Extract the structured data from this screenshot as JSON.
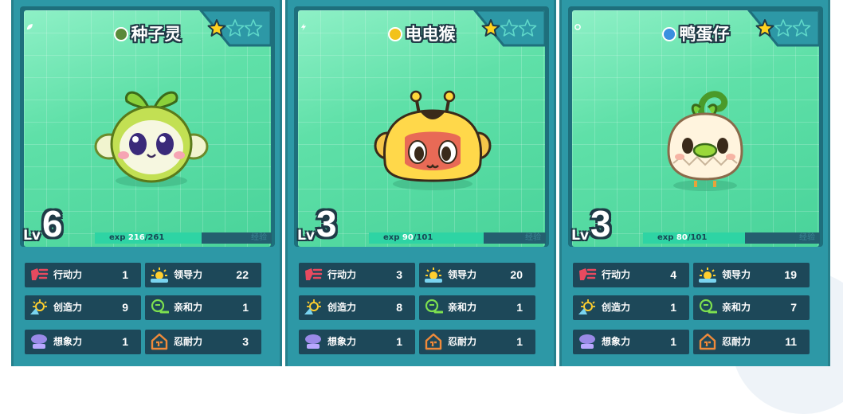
{
  "cards": [
    {
      "name": "种子灵",
      "type_icon": "leaf-type-icon",
      "type_color": "#5a8a3a",
      "stars_filled": 1,
      "stars_total": 3,
      "level_label": "Lv",
      "level": "6",
      "exp_label": "exp",
      "exp_current": "216",
      "exp_max": "/261",
      "exp_fraction": 0.83,
      "exp_tag": "经验",
      "creature": "seed-sprite",
      "stats": [
        {
          "label": "行动力",
          "value": "1",
          "icon": "action-icon"
        },
        {
          "label": "领导力",
          "value": "22",
          "icon": "leadership-icon"
        },
        {
          "label": "创造力",
          "value": "9",
          "icon": "creativity-icon"
        },
        {
          "label": "亲和力",
          "value": "1",
          "icon": "affinity-icon"
        },
        {
          "label": "想象力",
          "value": "1",
          "icon": "imagination-icon"
        },
        {
          "label": "忍耐力",
          "value": "3",
          "icon": "endurance-icon"
        }
      ]
    },
    {
      "name": "电电猴",
      "type_icon": "lightning-type-icon",
      "type_color": "#f2c21c",
      "stars_filled": 1,
      "stars_total": 3,
      "level_label": "Lv",
      "level": "3",
      "exp_label": "exp",
      "exp_current": "90",
      "exp_max": "/101",
      "exp_fraction": 0.89,
      "exp_tag": "经验",
      "creature": "electric-monkey",
      "stats": [
        {
          "label": "行动力",
          "value": "3",
          "icon": "action-icon"
        },
        {
          "label": "领导力",
          "value": "20",
          "icon": "leadership-icon"
        },
        {
          "label": "创造力",
          "value": "8",
          "icon": "creativity-icon"
        },
        {
          "label": "亲和力",
          "value": "1",
          "icon": "affinity-icon"
        },
        {
          "label": "想象力",
          "value": "1",
          "icon": "imagination-icon"
        },
        {
          "label": "忍耐力",
          "value": "1",
          "icon": "endurance-icon"
        }
      ]
    },
    {
      "name": "鸭蛋仔",
      "type_icon": "water-type-icon",
      "type_color": "#3b8fe0",
      "stars_filled": 1,
      "stars_total": 3,
      "level_label": "Lv",
      "level": "3",
      "exp_label": "exp",
      "exp_current": "80",
      "exp_max": "/101",
      "exp_fraction": 0.79,
      "exp_tag": "经验",
      "creature": "egg-duck",
      "stats": [
        {
          "label": "行动力",
          "value": "4",
          "icon": "action-icon"
        },
        {
          "label": "领导力",
          "value": "19",
          "icon": "leadership-icon"
        },
        {
          "label": "创造力",
          "value": "1",
          "icon": "creativity-icon"
        },
        {
          "label": "亲和力",
          "value": "7",
          "icon": "affinity-icon"
        },
        {
          "label": "想象力",
          "value": "1",
          "icon": "imagination-icon"
        },
        {
          "label": "忍耐力",
          "value": "11",
          "icon": "endurance-icon"
        }
      ]
    }
  ]
}
